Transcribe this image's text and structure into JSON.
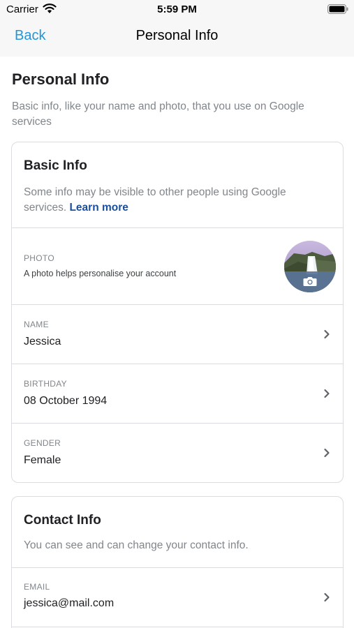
{
  "status_bar": {
    "carrier": "Carrier",
    "time": "5:59 PM"
  },
  "nav": {
    "back_label": "Back",
    "title": "Personal Info"
  },
  "page": {
    "title": "Personal Info",
    "subtitle": "Basic info, like your name and photo, that you use on Google services"
  },
  "basic_info": {
    "title": "Basic Info",
    "description": "Some info may be visible to other people using Google services.",
    "learn_more": "Learn more",
    "photo": {
      "label": "PHOTO",
      "hint": "A photo helps personalise your account"
    },
    "name": {
      "label": "NAME",
      "value": "Jessica"
    },
    "birthday": {
      "label": "BIRTHDAY",
      "value": "08 October 1994"
    },
    "gender": {
      "label": "GENDER",
      "value": "Female"
    }
  },
  "contact_info": {
    "title": "Contact Info",
    "description": "You can see and can change your contact info.",
    "email": {
      "label": "EMAIL",
      "value": "jessica@mail.com"
    }
  },
  "colors": {
    "accent": "#2196d9",
    "link": "#1a4fa0",
    "secondary_text": "#80868b",
    "divider": "#dadce0"
  },
  "icons": [
    "wifi-icon",
    "battery-icon",
    "camera-icon",
    "chevron-right-icon"
  ]
}
